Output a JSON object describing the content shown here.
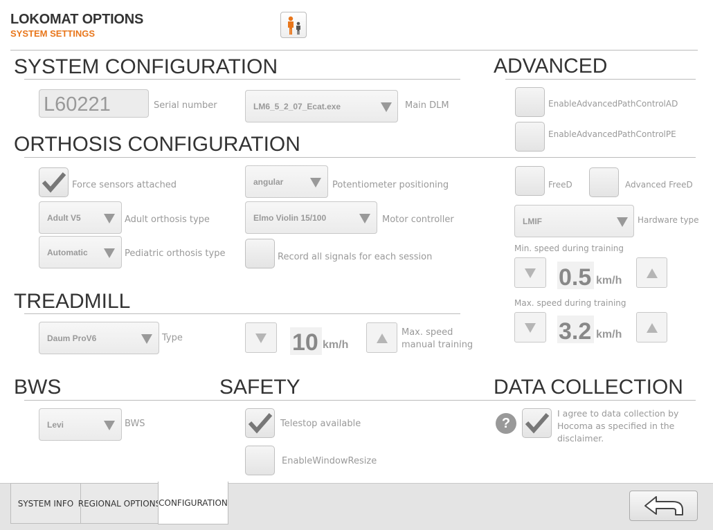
{
  "header": {
    "title": "LOKOMAT OPTIONS",
    "subtitle": "SYSTEM SETTINGS",
    "mode_icon": "adult-child-icon",
    "accent_color": "#e8761b"
  },
  "system_configuration": {
    "title": "SYSTEM CONFIGURATION",
    "serial_value": "L60221",
    "serial_label": "Serial number",
    "main_dlm_value": "LM6_5_2_07_Ecat.exe",
    "main_dlm_label": "Main DLM"
  },
  "advanced": {
    "title": "ADVANCED",
    "enable_adv_path_ad_label": "EnableAdvancedPathControlAD",
    "enable_adv_path_ad_checked": false,
    "enable_adv_path_pe_label": "EnableAdvancedPathControlPE",
    "enable_adv_path_pe_checked": false,
    "freed_label": "FreeD",
    "freed_checked": false,
    "advanced_freed_label": "Advanced FreeD",
    "advanced_freed_checked": false,
    "hardware_type_value": "LMIF",
    "hardware_type_label": "Hardware type",
    "min_speed_label": "Min. speed during training",
    "min_speed_value": "0.5",
    "min_speed_unit": "km/h",
    "max_speed_label": "Max. speed during training",
    "max_speed_value": "3.2",
    "max_speed_unit": "km/h"
  },
  "orthosis_configuration": {
    "title": "ORTHOSIS CONFIGURATION",
    "force_sensors_label": "Force sensors attached",
    "force_sensors_checked": true,
    "potentiometer_value": "angular",
    "potentiometer_label": "Potentiometer positioning",
    "adult_orthosis_value": "Adult V5",
    "adult_orthosis_label": "Adult orthosis type",
    "motor_controller_value": "Elmo Violin 15/100",
    "motor_controller_label": "Motor controller",
    "pediatric_orthosis_value": "Automatic",
    "pediatric_orthosis_label": "Pediatric orthosis type",
    "record_signals_label": "Record all signals for each session",
    "record_signals_checked": false
  },
  "treadmill": {
    "title": "TREADMILL",
    "type_value": "Daum ProV6",
    "type_label": "Type",
    "max_speed_value": "10",
    "max_speed_unit": "km/h",
    "max_speed_label": "Max. speed manual training"
  },
  "bws": {
    "title": "BWS",
    "value": "Levi",
    "label": "BWS"
  },
  "safety": {
    "title": "SAFETY",
    "telestop_label": "Telestop available",
    "telestop_checked": true,
    "window_resize_label": "EnableWindowResize",
    "window_resize_checked": false
  },
  "data_collection": {
    "title": "DATA COLLECTION",
    "agree_label": "I agree to data collection by Hocoma as specified in the disclaimer.",
    "agree_checked": true,
    "help_icon": "question-icon"
  },
  "tabs": [
    {
      "label": "SYSTEM INFO",
      "active": false
    },
    {
      "label": "REGIONAL OPTIONS",
      "active": false
    },
    {
      "label": "CONFIGURATION",
      "active": true
    }
  ],
  "back_button_icon": "back-arrow-icon"
}
